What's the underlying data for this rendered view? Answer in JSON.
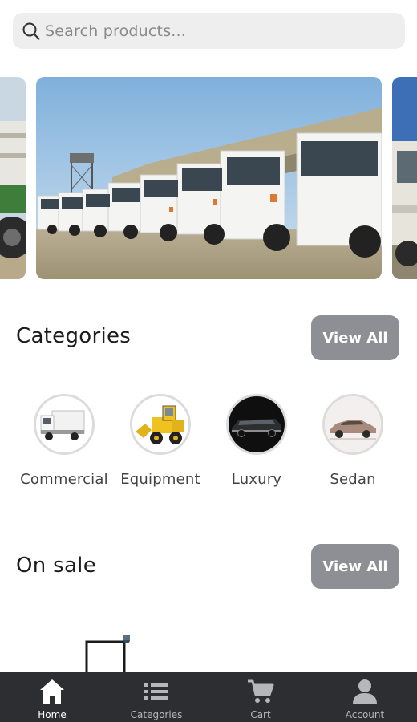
{
  "search": {
    "placeholder": "Search products...",
    "value": "",
    "icon": "search-icon"
  },
  "carousel": {
    "slides": [
      {
        "content": "tractor-photo"
      },
      {
        "content": "trucks-fleet-photo"
      },
      {
        "content": "vehicle-photo"
      }
    ]
  },
  "categories": {
    "title": "Categories",
    "view_all_label": "View All",
    "items": [
      {
        "label": "Commercial",
        "image": "white-truck-image"
      },
      {
        "label": "Equipment",
        "image": "wheel-loader-image"
      },
      {
        "label": "Luxury",
        "image": "limousine-image"
      },
      {
        "label": "Sedan",
        "image": "sedan-image"
      }
    ]
  },
  "on_sale": {
    "title": "On sale",
    "view_all_label": "View All"
  },
  "bottom_nav": {
    "items": [
      {
        "label": "Home",
        "icon": "home-icon",
        "active": true
      },
      {
        "label": "Categories",
        "icon": "list-icon",
        "active": false
      },
      {
        "label": "Cart",
        "icon": "cart-icon",
        "active": false
      },
      {
        "label": "Account",
        "icon": "account-icon",
        "active": false
      }
    ]
  },
  "colors": {
    "search_bg": "#eeeeef",
    "button_bg": "#8d8f95",
    "nav_bg": "#2d2e31",
    "nav_active": "#ffffff",
    "nav_inactive": "#b6b7ba"
  }
}
